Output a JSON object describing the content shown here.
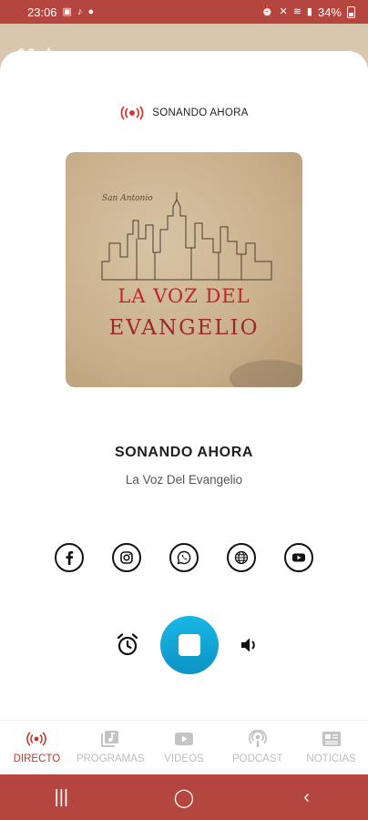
{
  "status_bar": {
    "time": "23:06",
    "battery": "34%"
  },
  "header": {
    "live_label": "SONANDO AHORA"
  },
  "cover": {
    "script_text": "San Antonio",
    "line1": "LA VOZ DEL",
    "line2": "EVANGELIO"
  },
  "now_playing": {
    "title": "SONANDO AHORA",
    "station": "La Voz Del Evangelio"
  },
  "socials": [
    {
      "name": "facebook-icon"
    },
    {
      "name": "instagram-icon"
    },
    {
      "name": "whatsapp-icon"
    },
    {
      "name": "globe-icon"
    },
    {
      "name": "youtube-icon"
    }
  ],
  "player": {
    "state": "playing",
    "accent_color": "#14a9d8"
  },
  "bottom_nav": {
    "items": [
      {
        "label": "DIRECTO",
        "icon": "live-icon",
        "active": true
      },
      {
        "label": "PROGRAMAS",
        "icon": "playlist-icon",
        "active": false
      },
      {
        "label": "VIDEOS",
        "icon": "video-icon",
        "active": false
      },
      {
        "label": "PODCAST",
        "icon": "podcast-icon",
        "active": false
      },
      {
        "label": "NOTICIAS",
        "icon": "news-icon",
        "active": false
      }
    ]
  },
  "colors": {
    "brand": "#b5453f",
    "active_nav": "#c0392b",
    "inactive_nav": "#bdbdbd"
  }
}
